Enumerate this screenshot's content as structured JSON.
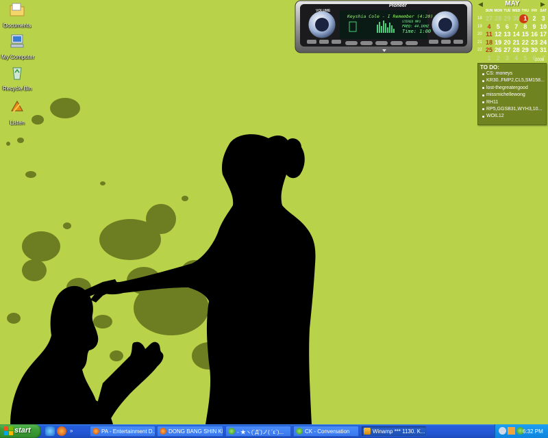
{
  "desktop": {
    "icons": [
      {
        "label": "Documents",
        "icon": "documents-folder-icon"
      },
      {
        "label": "My Computer",
        "icon": "my-computer-icon"
      },
      {
        "label": "Recycle Bin",
        "icon": "recycle-bin-icon"
      },
      {
        "label": "Listen",
        "icon": "listen-shortcut-icon"
      }
    ],
    "wallpaper": {
      "background": "#b8d24a",
      "splatter": "#6f7f22",
      "silhouette": "#000000"
    }
  },
  "player": {
    "brand": "Pioneer",
    "volume_label": "VOLUME",
    "track": "Keyshia Cole - I Remember (4:20)",
    "stereo": "STEREO MP3",
    "freq": "FREQ: 44.1KHZ",
    "time": "Time: 1:00"
  },
  "calendar": {
    "month": "MAY",
    "year": "2008",
    "weekdays": [
      "SUN",
      "MON",
      "TUE",
      "WED",
      "THU",
      "FRI",
      "SAT"
    ],
    "week_numbers": [
      "18",
      "19",
      "20",
      "21",
      "22"
    ],
    "days": [
      [
        "27",
        "28",
        "29",
        "30",
        "1",
        "2",
        "3"
      ],
      [
        "4",
        "5",
        "6",
        "7",
        "8",
        "9",
        "10"
      ],
      [
        "11",
        "12",
        "13",
        "14",
        "15",
        "16",
        "17"
      ],
      [
        "18",
        "19",
        "20",
        "21",
        "22",
        "23",
        "24"
      ],
      [
        "25",
        "26",
        "27",
        "28",
        "29",
        "30",
        "31"
      ],
      [
        "1",
        "2",
        "3",
        "4",
        "5",
        "6",
        "7"
      ]
    ],
    "today": "1"
  },
  "todo": {
    "title": "TO DO:",
    "items": [
      "CS: moneys",
      "KR30..FMP2,CL5,SM158...",
      "lost-thegreatergood",
      "missmichellewong",
      "RH11",
      "RP5,GGSB31,WYH3,10...",
      "WOIL12"
    ]
  },
  "taskbar": {
    "start_label": "start",
    "quick_launch": [
      "ie-icon",
      "firefox-icon",
      "show-more-icon"
    ],
    "buttons": [
      {
        "label": "PA - Entertainment D...",
        "icon": "firefox-icon"
      },
      {
        "label": "DONG BANG SHIN KI ...",
        "icon": "firefox-icon"
      },
      {
        "label": "- ★ヽ(´Д`)ノ( ´ε`)...",
        "icon": "msn-icon"
      },
      {
        "label": "CK - Conversation",
        "icon": "msn-icon"
      },
      {
        "label": "Winamp *** 1130. K...",
        "icon": "winamp-icon"
      }
    ],
    "clock": "6:32 PM"
  }
}
